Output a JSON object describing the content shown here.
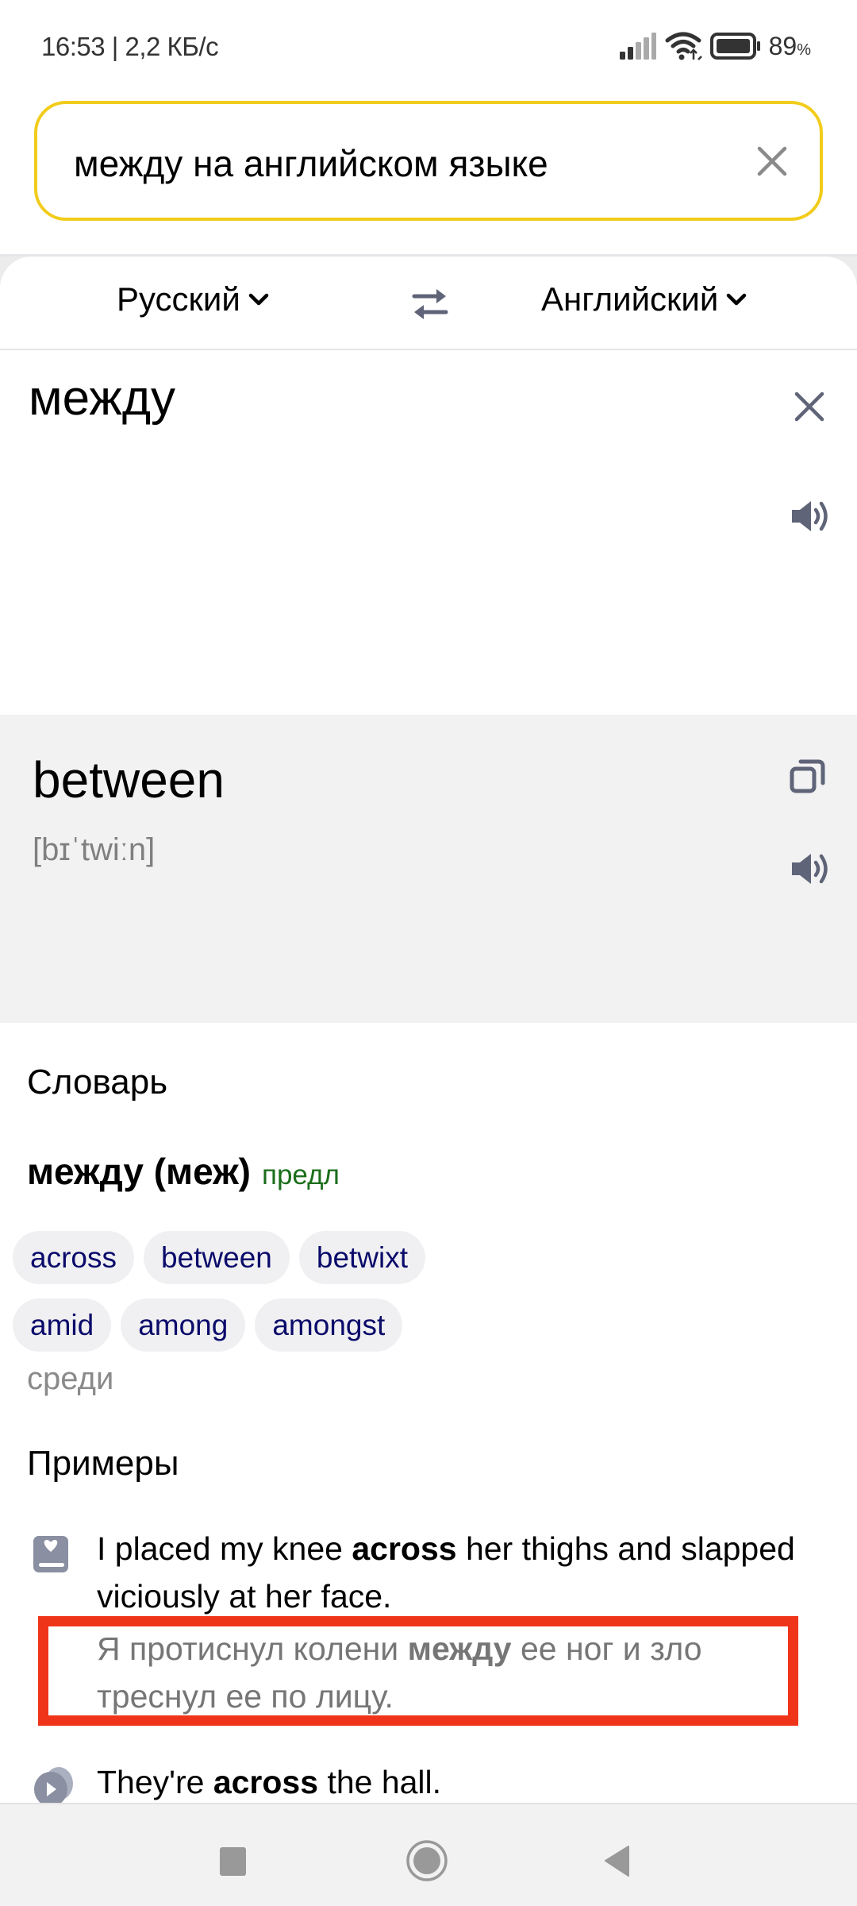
{
  "status_bar": {
    "time_speed": "16:53 | 2,2 КБ/с",
    "battery_percent": "89",
    "battery_symbol": "%",
    "battery_level": 0.89,
    "icons": [
      "signal-icon",
      "wifi-icon",
      "battery-icon"
    ]
  },
  "search": {
    "query": "между на английском языке",
    "clear_icon": "close-icon"
  },
  "languages": {
    "source": "Русский",
    "target": "Английский",
    "swap_icon": "swap-arrows-icon"
  },
  "source_pane": {
    "text": "между"
  },
  "translation_pane": {
    "text": "between",
    "transcription": "[bɪˈtwiːn]"
  },
  "dictionary": {
    "title": "Словарь",
    "entry_word": "между (меж)",
    "part_of_speech": "предл",
    "translations_row1": [
      "across",
      "between",
      "betwixt"
    ],
    "translations_row2": [
      "amid",
      "among",
      "amongst"
    ],
    "other": "среди"
  },
  "examples": {
    "title": "Примеры",
    "items": [
      {
        "source_pre": "I placed my knee ",
        "source_bold": "across",
        "source_post": " her thighs and slapped viciously at her face.",
        "translation_pre": "Я протиснул колени ",
        "translation_bold": "между",
        "translation_post": " ее ног и зло треснул ее по лицу.",
        "icon": "book-heart-icon"
      },
      {
        "source_pre": "They're ",
        "source_bold": "across",
        "source_post": " the hall.",
        "icon": "video-play-icon"
      }
    ]
  },
  "colors": {
    "search_border": "#f2cc1c",
    "icon_gray": "#5f6478",
    "chip_text": "#0b0b6b",
    "pos_green": "#1b6e1b",
    "annotation_red": "#f0341a"
  }
}
